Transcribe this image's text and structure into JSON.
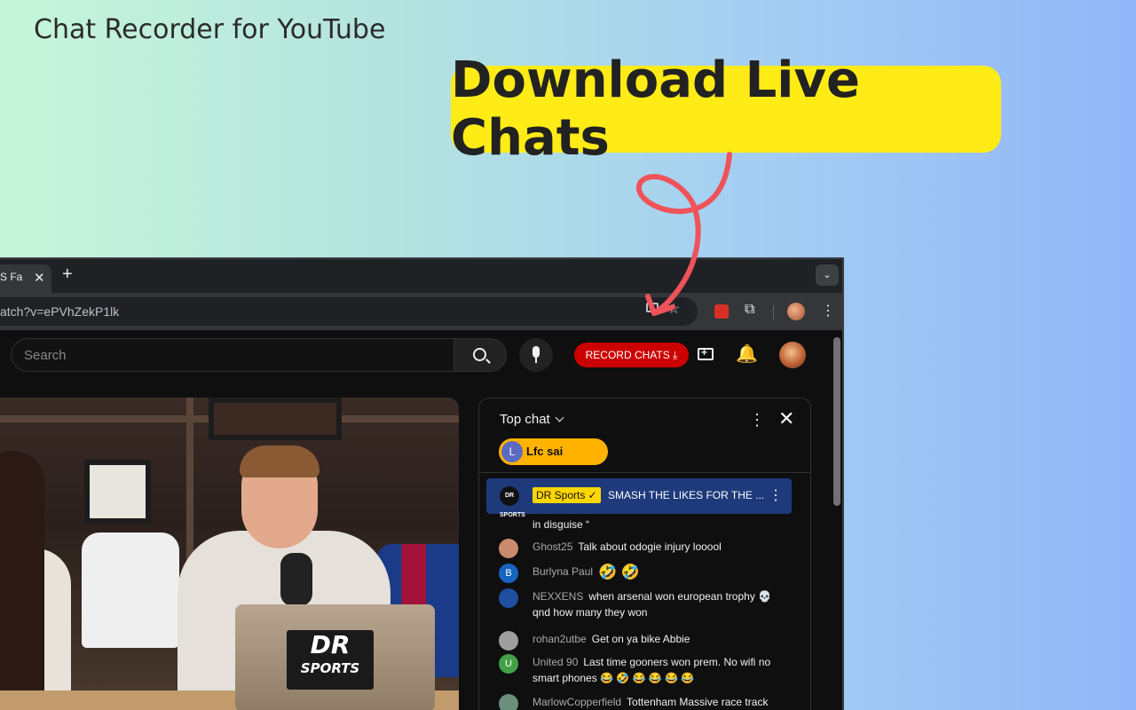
{
  "promo": {
    "title": "Chat Recorder for YouTube",
    "headline": "Download Live Chats",
    "headline_bg": "#ffec17",
    "arrow_color": "#f0525a"
  },
  "browser": {
    "tab_title": "S Fa",
    "tab_close": "✕",
    "new_tab": "+",
    "tab_menu": "⌄",
    "url": "atch?v=ePVhZekP1lk",
    "star": "☆",
    "puzzle": "⧉",
    "kebab": "⋮"
  },
  "youtube": {
    "search_placeholder": "Search",
    "record_button": "RECORD CHATS ⤓",
    "record_color": "#cc0000",
    "bell": "🔔"
  },
  "video": {
    "logo_big": "DR",
    "logo_small": "SPORTS"
  },
  "chat": {
    "mode": "Top chat",
    "kebab": "⋮",
    "close": "✕",
    "donor": {
      "initial": "L",
      "name": "Lfc sai"
    },
    "pinned": {
      "avatar_text": "DR SPORTS",
      "author": "DR Sports ✓",
      "text": "SMASH THE LIKES FOR THE ...",
      "kebab": "⋮",
      "bg": "#1e3a7b"
    },
    "messages": [
      {
        "avatar": "",
        "avatar_color": "#333",
        "author": "",
        "text": "in disguise “"
      },
      {
        "avatar": "",
        "avatar_color": "#c98b6b",
        "author": "Ghost25",
        "text": "Talk about odogie injury looool"
      },
      {
        "avatar": "B",
        "avatar_color": "#1565c0",
        "author": "Burlyna Paul",
        "text": "🤣 🤣"
      },
      {
        "avatar": "",
        "avatar_color": "#1e4fa0",
        "author": "NEXXENS",
        "text": "when arsenal won european trophy 💀 qnd how many they won"
      },
      {
        "avatar": "",
        "avatar_color": "#9e9e9e",
        "author": "rohan2utbe",
        "text": "Get on ya bike Abbie"
      },
      {
        "avatar": "U",
        "avatar_color": "#43a047",
        "author": "United 90",
        "text": "Last time gooners won prem. No wifi no smart phones 😂 🤣 😂 😂 😂 😂"
      },
      {
        "avatar": "",
        "avatar_color": "#6a8f7a",
        "author": "MarlowCopperfield",
        "text": "Tottenham Massive race track"
      }
    ]
  }
}
